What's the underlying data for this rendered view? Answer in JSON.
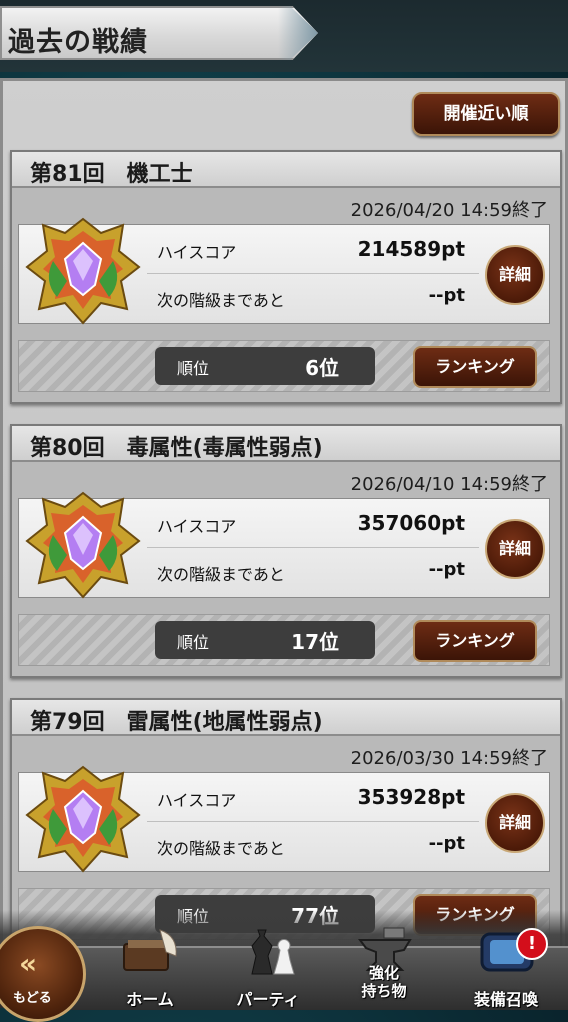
{
  "header": {
    "title": "過去の戦績"
  },
  "toolbar": {
    "sort_label": "開催近い順"
  },
  "events": [
    {
      "title": "第81回　機工士",
      "end_date": "2026/04/20 14:59終了",
      "hiscore_label": "ハイスコア",
      "hiscore_value": "214589pt",
      "next_label": "次の階級まであと",
      "next_value": "--pt",
      "detail_label": "詳細",
      "rank_label": "順位",
      "rank_value": "6位",
      "ranking_label": "ランキング"
    },
    {
      "title": "第80回　毒属性(毒属性弱点)",
      "end_date": "2026/04/10 14:59終了",
      "hiscore_label": "ハイスコア",
      "hiscore_value": "357060pt",
      "next_label": "次の階級まであと",
      "next_value": "--pt",
      "detail_label": "詳細",
      "rank_label": "順位",
      "rank_value": "17位",
      "ranking_label": "ランキング"
    },
    {
      "title": "第79回　雷属性(地属性弱点)",
      "end_date": "2026/03/30 14:59終了",
      "hiscore_label": "ハイスコア",
      "hiscore_value": "353928pt",
      "next_label": "次の階級まであと",
      "next_value": "--pt",
      "detail_label": "詳細",
      "rank_label": "順位",
      "rank_value": "77位",
      "ranking_label": "ランキング"
    }
  ],
  "nav": {
    "back_label": "もどる",
    "home_label": "ホーム",
    "party_label": "パーティ",
    "enhance_label": "強化\n持ち物",
    "summon_label": "装備召喚",
    "summon_badge": "!"
  },
  "colors": {
    "accent_brown": "#5a2210",
    "badge_red": "#d30e1b",
    "panel_gray": "#c8c8c8"
  }
}
